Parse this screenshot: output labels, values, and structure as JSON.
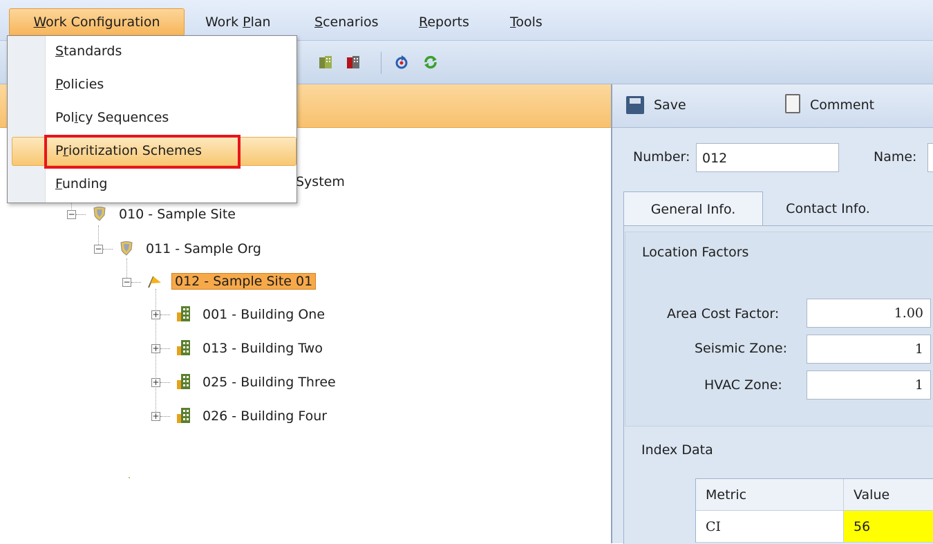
{
  "menubar": {
    "items": [
      {
        "label": "Work Configuration",
        "mnemonic": "W",
        "rest": "ork Configuration"
      },
      {
        "label": "Work Plan",
        "before": "Work ",
        "mnemonic": "P",
        "rest": "lan"
      },
      {
        "label": "Scenarios",
        "mnemonic": "S",
        "rest": "cenarios"
      },
      {
        "label": "Reports",
        "mnemonic": "R",
        "rest": "eports"
      },
      {
        "label": "Tools",
        "mnemonic": "T",
        "rest": "ools"
      }
    ]
  },
  "dropdown": {
    "items": [
      {
        "label": "Standards",
        "mnemonic": "S",
        "rest": "tandards"
      },
      {
        "label": "Policies",
        "mnemonic": "P",
        "rest": "olicies"
      },
      {
        "label": "Policy Sequences",
        "before": "Pol",
        "mnemonic": "i",
        "rest": "cy Sequences"
      },
      {
        "label": "Prioritization Schemes",
        "before": "P",
        "mnemonic": "r",
        "rest": "ioritization Schemes"
      },
      {
        "label": "Funding",
        "mnemonic": "F",
        "rest": "unding"
      }
    ],
    "highlighted": "Prioritization Schemes"
  },
  "tree": {
    "partial_system_label": "System",
    "nodes": [
      {
        "label": "010 - Sample Site",
        "icon": "shield-icon",
        "expander": "−"
      },
      {
        "label": "011 - Sample Org",
        "icon": "shield-icon",
        "expander": "−"
      },
      {
        "label": "012 - Sample Site 01",
        "icon": "flag-icon",
        "expander": "−",
        "selected": true
      },
      {
        "label": "001 - Building One",
        "icon": "building-icon",
        "expander": "+"
      },
      {
        "label": "013 - Building Two",
        "icon": "building-icon",
        "expander": "+"
      },
      {
        "label": "025 - Building Three",
        "icon": "building-icon",
        "expander": "+"
      },
      {
        "label": "026 - Building Four",
        "icon": "building-icon",
        "expander": "+"
      }
    ]
  },
  "details": {
    "toolbar": {
      "save_label": "Save",
      "comment_label": "Comment"
    },
    "number_label": "Number:",
    "number_value": "012",
    "name_label": "Name:",
    "tabs": [
      "General Info.",
      "Contact Info."
    ],
    "location_factors": {
      "title": "Location Factors",
      "fields": [
        {
          "label": "Area Cost Factor:",
          "value": "1.00"
        },
        {
          "label": "Seismic Zone:",
          "value": "1"
        },
        {
          "label": "HVAC Zone:",
          "value": "1"
        }
      ]
    },
    "index_data": {
      "title": "Index Data",
      "columns": [
        "Metric",
        "Value"
      ],
      "rows": [
        {
          "metric": "CI",
          "value": "56",
          "highlight_color": "#ffff00"
        }
      ]
    }
  },
  "colors": {
    "menu_active": "#f7b55a",
    "selection": "#f7a94a",
    "callout": "#e8141c"
  }
}
